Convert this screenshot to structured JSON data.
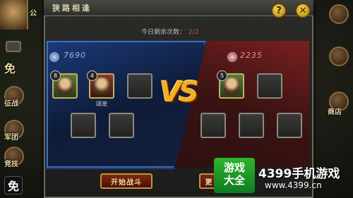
{
  "window": {
    "title": "狭路相逢"
  },
  "remaining": {
    "label": "今日剩余次数：",
    "value": "2/2"
  },
  "left_side": {
    "power": "7690",
    "heroes": [
      {
        "level": "8",
        "name": ""
      },
      {
        "level": "4",
        "name": "颂宠"
      }
    ]
  },
  "right_side": {
    "power": "2235",
    "heroes": [
      {
        "level": "5",
        "name": ""
      }
    ]
  },
  "vs_text": "VS",
  "buttons": {
    "start": "开始战斗",
    "other": "更"
  },
  "side_menu": {
    "left_labels": [
      "公",
      "免",
      "征战",
      "军团",
      "竞技"
    ],
    "right_labels": [
      "商店"
    ]
  },
  "watermark": {
    "logo": "游戏\n大全",
    "line1": "4399手机游戏",
    "url": "www.4399.cn"
  },
  "badge": "免"
}
